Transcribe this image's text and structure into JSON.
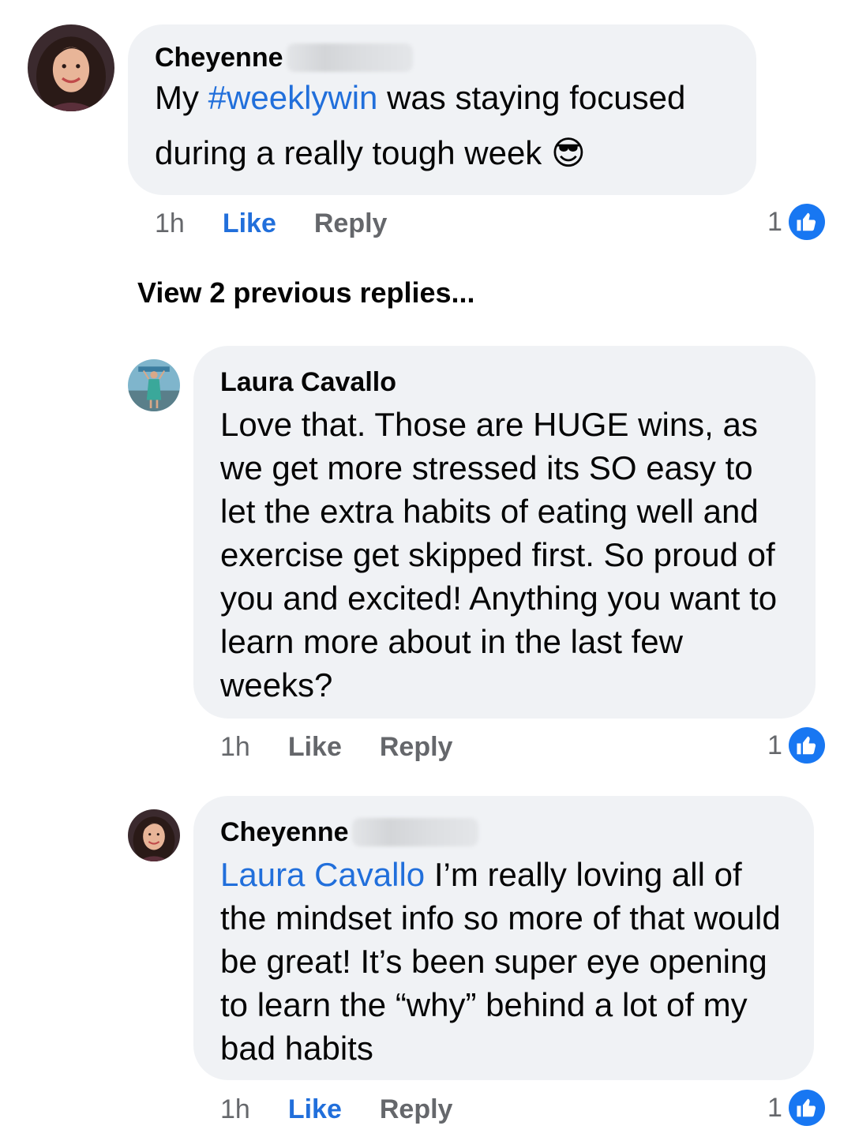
{
  "comments": [
    {
      "author": "Cheyenne",
      "surname_blurred": true,
      "segments": [
        {
          "text": "My ",
          "type": "text"
        },
        {
          "text": "#weeklywin",
          "type": "hashtag"
        },
        {
          "text": " was staying focused during a really tough week ",
          "type": "text"
        }
      ],
      "emoji": "😎",
      "time": "1h",
      "like_label": "Like",
      "reply_label": "Reply",
      "reaction_count": "1",
      "liked": true
    },
    {
      "author": "Laura Cavallo",
      "surname_blurred": false,
      "text": "Love that. Those are HUGE wins, as we get more stressed its SO easy to let the extra habits of eating well and exercise get skipped first. So proud of you and excited! Anything you want to learn more about in the last few weeks?",
      "time": "1h",
      "like_label": "Like",
      "reply_label": "Reply",
      "reaction_count": "1",
      "liked": false
    },
    {
      "author": "Cheyenne",
      "surname_blurred": true,
      "mention": "Laura Cavallo",
      "text": " I’m really loving all of the mindset info so more of that would be great! It’s been super eye opening to learn the “why” behind a lot of my bad habits",
      "time": "1h",
      "like_label": "Like",
      "reply_label": "Reply",
      "reaction_count": "1",
      "liked": true
    }
  ],
  "view_previous_replies": "View 2 previous replies...",
  "icons": {
    "reaction": "thumbs-up-icon"
  },
  "colors": {
    "bubble": "#f0f2f5",
    "link": "#216fdb",
    "muted": "#65676b",
    "like_badge": "#1877f2"
  }
}
